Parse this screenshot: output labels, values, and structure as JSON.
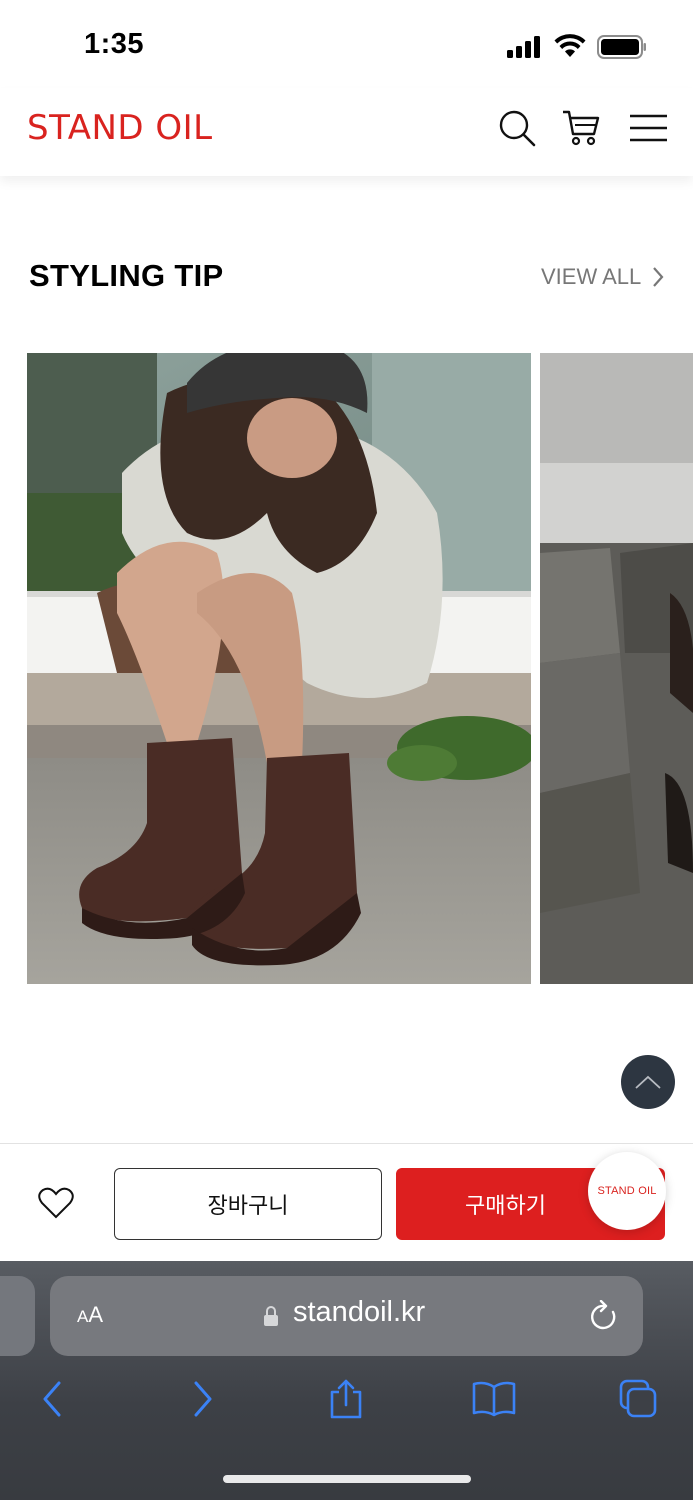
{
  "status_bar": {
    "time": "1:35"
  },
  "header": {
    "logo": "STAND OIL",
    "icons": [
      "search-icon",
      "cart-icon",
      "menu-icon"
    ],
    "logo_color": "#d9231f"
  },
  "styling_tip": {
    "title": "STYLING TIP",
    "view_all": "VIEW ALL"
  },
  "purchase_bar": {
    "cart_label": "장바구니",
    "buy_label": "구매하기",
    "badge_label": "STAND OIL",
    "buy_color": "#dd1f1f"
  },
  "browser": {
    "aa_big": "A",
    "aa_small": "A",
    "url": "standoil.kr"
  }
}
